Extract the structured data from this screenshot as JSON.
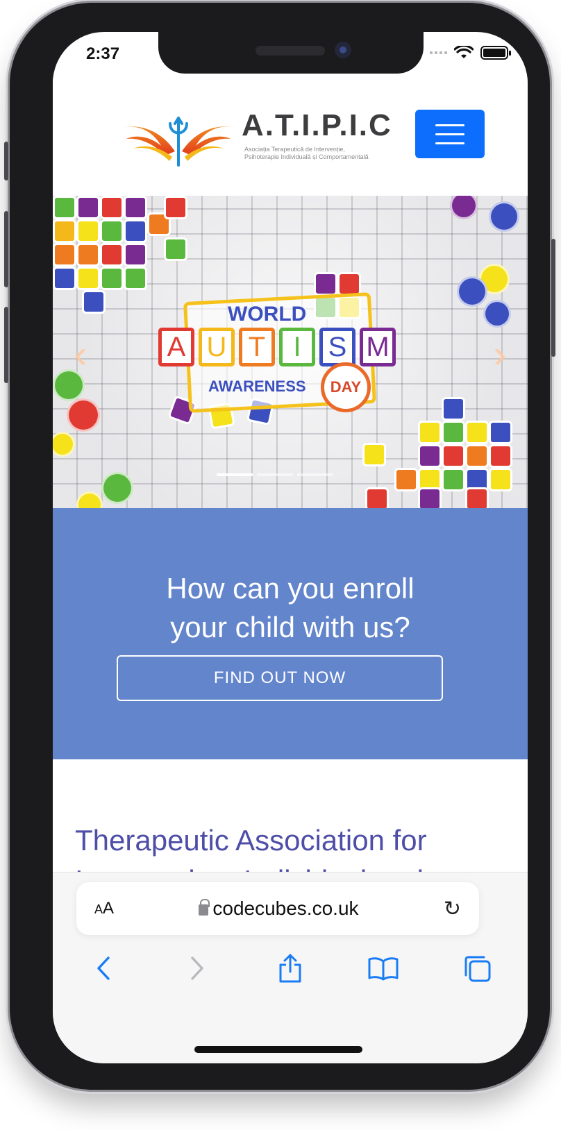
{
  "status_bar": {
    "time": "2:37"
  },
  "header": {
    "logo_title": "A.T.I.P.I.C",
    "logo_subtitle": "Asociația Terapeutică de Intervenție, Psihoterapie Individuală și Comportamentală",
    "menu_icon": "hamburger-icon",
    "menu_color": "#0d6efd"
  },
  "hero": {
    "world": "WORLD",
    "letters": [
      "A",
      "U",
      "T",
      "I",
      "S",
      "M"
    ],
    "letter_colors": [
      "#e03a32",
      "#f5b81b",
      "#ef7b21",
      "#5ab83f",
      "#3b4fbf",
      "#7a2b92"
    ],
    "awareness": "AWARENESS",
    "day": "DAY",
    "prev_icon": "chevron-left-icon",
    "next_icon": "chevron-right-icon",
    "prev_glyph": "‹",
    "next_glyph": "›",
    "active_slide": 1,
    "slide_count": 3
  },
  "enroll": {
    "title_line1": "How can you enroll",
    "title_line2": "your child with us?",
    "button_label": "FIND OUT NOW",
    "background": "#6385cc"
  },
  "about": {
    "title": "Therapeutic Association for Intervention, Individual and"
  },
  "browser": {
    "text_size_label_small": "A",
    "text_size_label_big": "A",
    "url": "codecubes.co.uk",
    "reload_glyph": "↻",
    "accent": "#1a7cf5"
  }
}
